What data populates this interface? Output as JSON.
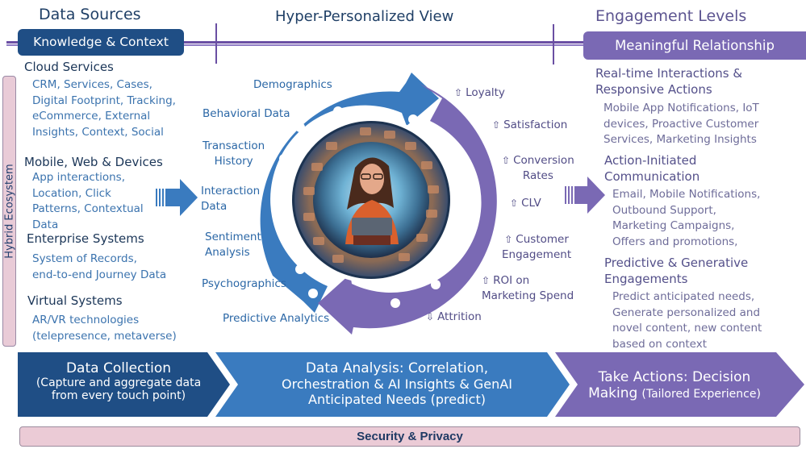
{
  "headers": {
    "data_sources": "Data Sources",
    "hyper_personalized_view": "Hyper-Personalized View",
    "engagement_levels": "Engagement Levels"
  },
  "pills": {
    "knowledge_context": "Knowledge & Context",
    "meaningful_relationship": "Meaningful Relationship"
  },
  "hybrid_ecosystem": "Hybrid Ecosystem",
  "data_sources": [
    {
      "title": "Cloud Services",
      "lines": [
        "CRM, Services, Cases,",
        "Digital Footprint, Tracking,",
        "eCommerce, External",
        "Insights, Context, Social"
      ]
    },
    {
      "title": "Mobile, Web & Devices",
      "lines": [
        "App interactions,",
        "Location, Click",
        "Patterns, Contextual",
        "Data"
      ]
    },
    {
      "title": "Enterprise Systems",
      "lines": [
        "System of Records,",
        "end-to-end Journey Data"
      ]
    },
    {
      "title": "Virtual Systems",
      "lines": [
        "AR/VR technologies",
        "(telepresence,  metaverse)"
      ]
    }
  ],
  "analysis_inputs": [
    {
      "lines": [
        "Demographics"
      ]
    },
    {
      "lines": [
        "Behavioral Data"
      ]
    },
    {
      "lines": [
        "Transaction",
        "History"
      ]
    },
    {
      "lines": [
        "Interaction",
        "Data"
      ]
    },
    {
      "lines": [
        "Sentiment",
        "Analysis"
      ]
    },
    {
      "lines": [
        "Psychographics"
      ]
    },
    {
      "lines": [
        "Predictive Analytics"
      ]
    }
  ],
  "outcomes": [
    {
      "direction": "up",
      "arrow": "⇧",
      "lines": [
        "Loyalty"
      ]
    },
    {
      "direction": "up",
      "arrow": "⇧",
      "lines": [
        "Satisfaction"
      ]
    },
    {
      "direction": "up",
      "arrow": "⇧",
      "lines": [
        "Conversion",
        "Rates"
      ]
    },
    {
      "direction": "up",
      "arrow": "⇧",
      "lines": [
        "CLV"
      ]
    },
    {
      "direction": "up",
      "arrow": "⇧",
      "lines": [
        "Customer",
        "Engagement"
      ]
    },
    {
      "direction": "up",
      "arrow": "⇧",
      "lines": [
        "ROI on",
        "Marketing Spend"
      ]
    },
    {
      "direction": "down",
      "arrow": "⇩",
      "lines": [
        "Attrition"
      ]
    }
  ],
  "engagements": [
    {
      "title_lines": [
        "Real-time Interactions &",
        "Responsive Actions"
      ],
      "lines": [
        "Mobile App Notifications, IoT",
        "devices, Proactive Customer",
        "Services, Marketing Insights"
      ]
    },
    {
      "title_lines": [
        "Action-Initiated",
        "Communication"
      ],
      "lines": [
        "Email, Mobile Notifications,",
        "Outbound Support,",
        "Marketing Campaigns,",
        "Offers and promotions,"
      ]
    },
    {
      "title_lines": [
        "Predictive & Generative",
        "Engagements"
      ],
      "lines": [
        "Predict anticipated needs,",
        "Generate personalized and",
        "novel content, new content",
        "based on context"
      ]
    }
  ],
  "center_image": {
    "description": "Illustration of a woman holding a tablet surrounded by a ring of digital icons and screens"
  },
  "process_steps": [
    {
      "title": "Data Collection",
      "subtitle_lines": [
        "(Capture and aggregate data",
        "from every touch point)"
      ]
    },
    {
      "title": "Data Analysis",
      "title_rest": ": Correlation,",
      "subtitle_lines": [
        "Orchestration & AI Insights & GenAI",
        "Anticipated Needs (predict)"
      ]
    },
    {
      "title": "Take Actions: Decision",
      "title2": "Making",
      "subtitle": "(Tailored Experience)"
    }
  ],
  "footer": "Security & Privacy",
  "colors": {
    "dark_blue": "#1f4e85",
    "mid_blue": "#3a7bbf",
    "purple": "#7a69b4",
    "pink_bar": "#ebcbd6",
    "timeline": "#6a4fa3"
  }
}
